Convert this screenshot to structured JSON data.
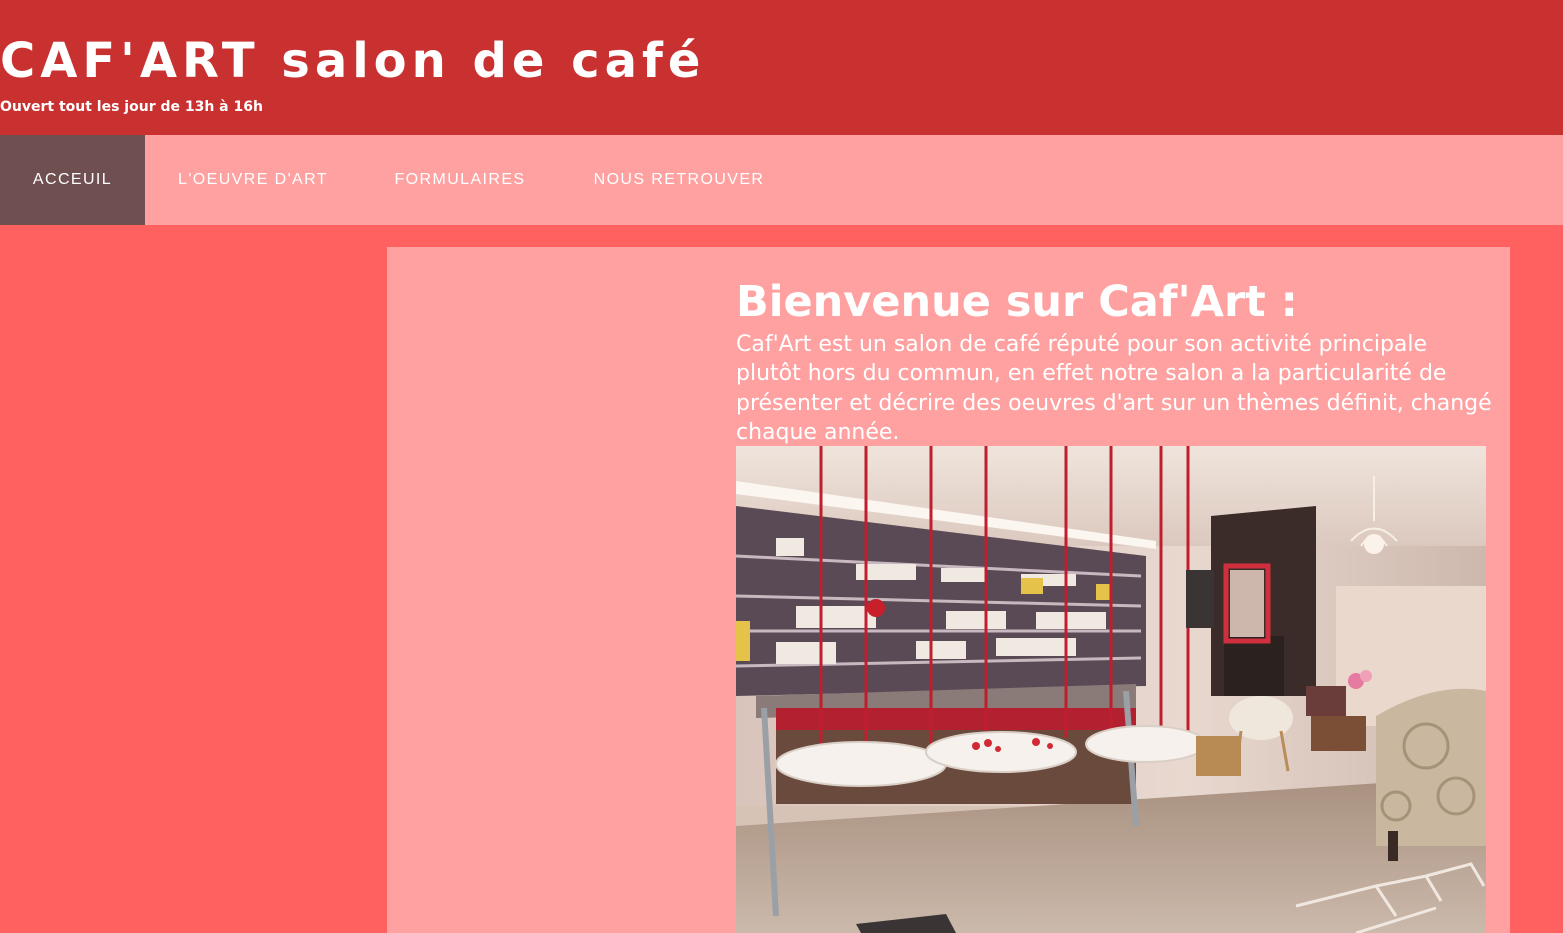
{
  "header": {
    "title": "CAF'ART salon de café",
    "tagline": "Ouvert tout les jour de 13h à 16h"
  },
  "nav": {
    "items": [
      {
        "label": "ACCEUIL",
        "active": true
      },
      {
        "label": "L'OEUVRE D'ART",
        "active": false
      },
      {
        "label": "FORMULAIRES",
        "active": false
      },
      {
        "label": "NOUS RETROUVER",
        "active": false
      }
    ]
  },
  "main": {
    "heading": "Bienvenue sur Caf'Art :",
    "intro": "Caf'Art est un salon de café réputé pour son activité principale plutôt hors du commun, en effet notre salon a la particularité de présenter et décrire des oeuvres d'art sur un thèmes définit, changé chaque année."
  },
  "colors": {
    "header_bg": "#c93131",
    "nav_bg": "#ffa1a1",
    "nav_active_bg": "#6f4f4f",
    "page_bg": "#ff6161",
    "panel_bg": "#ffa1a1",
    "text": "#ffffff"
  },
  "images": {
    "cafe_photo": "cafe-interior-photo"
  }
}
